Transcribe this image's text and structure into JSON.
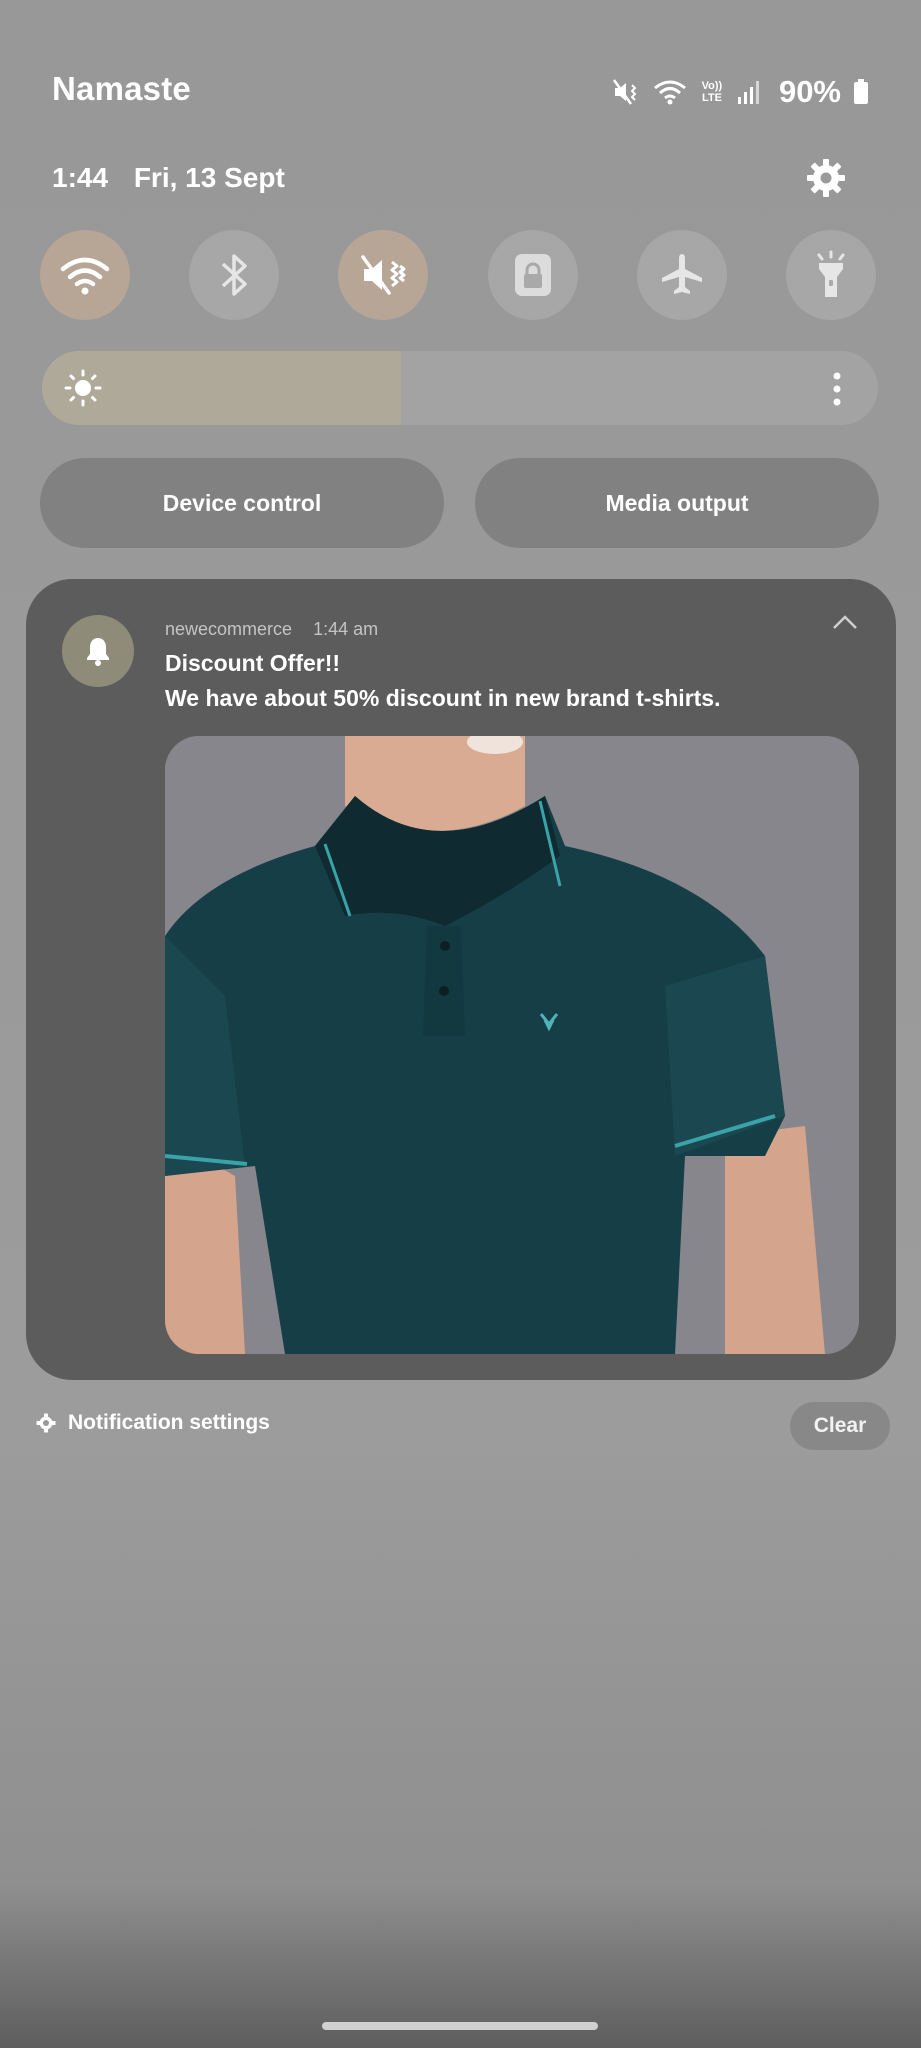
{
  "status_bar": {
    "carrier": "Namaste",
    "volte": "Vo)) LTE",
    "battery": "90%",
    "icons": [
      "mute-vibrate-icon",
      "wifi-icon",
      "volte-icon",
      "signal-icon",
      "battery-icon"
    ]
  },
  "header": {
    "time": "1:44",
    "date": "Fri, 13 Sept",
    "settings_icon": "gear-icon"
  },
  "quick_settings": {
    "tiles": [
      {
        "name": "wifi",
        "icon": "wifi-icon",
        "active": true
      },
      {
        "name": "bluetooth",
        "icon": "bluetooth-icon",
        "active": false
      },
      {
        "name": "sound",
        "icon": "vibrate-icon",
        "active": true
      },
      {
        "name": "lock-screen",
        "icon": "lock-icon",
        "active": false
      },
      {
        "name": "airplane-mode",
        "icon": "airplane-icon",
        "active": false
      },
      {
        "name": "flashlight",
        "icon": "flashlight-icon",
        "active": false
      }
    ],
    "brightness_level": 0.43,
    "device_control_label": "Device control",
    "media_output_label": "Media output"
  },
  "notification": {
    "app_name": "newecommerce",
    "time": "1:44 am",
    "title": "Discount Offer!!",
    "body": "We have about 50% discount in new brand t-shirts.",
    "image": "teal-polo-tshirt-photo"
  },
  "footer": {
    "notification_settings_label": "Notification settings",
    "clear_label": "Clear"
  },
  "colors": {
    "accent_tile": "#b7a596",
    "brightness_fill": "#afa99a",
    "notification_bg": "#5c5c5c",
    "shirt_teal": "#163e46"
  }
}
